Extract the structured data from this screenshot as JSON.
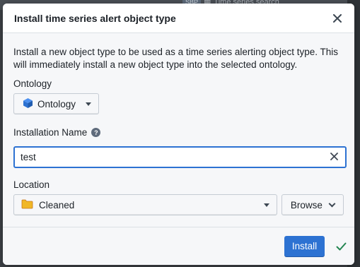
{
  "backdrop": {
    "tab_pill": "SBP",
    "tab_label": "Time series search"
  },
  "dialog": {
    "title": "Install time series alert object type",
    "description": "Install a new object type to be used as a time series alerting object type. This will immediately install a new object type into the selected ontology.",
    "ontology": {
      "label": "Ontology",
      "selected": "Ontology",
      "icon": "cube-icon",
      "icon_color": "#2d72d2"
    },
    "installation_name": {
      "label": "Installation Name",
      "value": "test",
      "help_icon": "help-icon"
    },
    "location": {
      "label": "Location",
      "selected": "Cleaned",
      "icon": "folder-icon",
      "icon_color": "#f0b726",
      "browse_label": "Browse"
    },
    "footer": {
      "install_label": "Install",
      "check_color": "#238551"
    }
  }
}
